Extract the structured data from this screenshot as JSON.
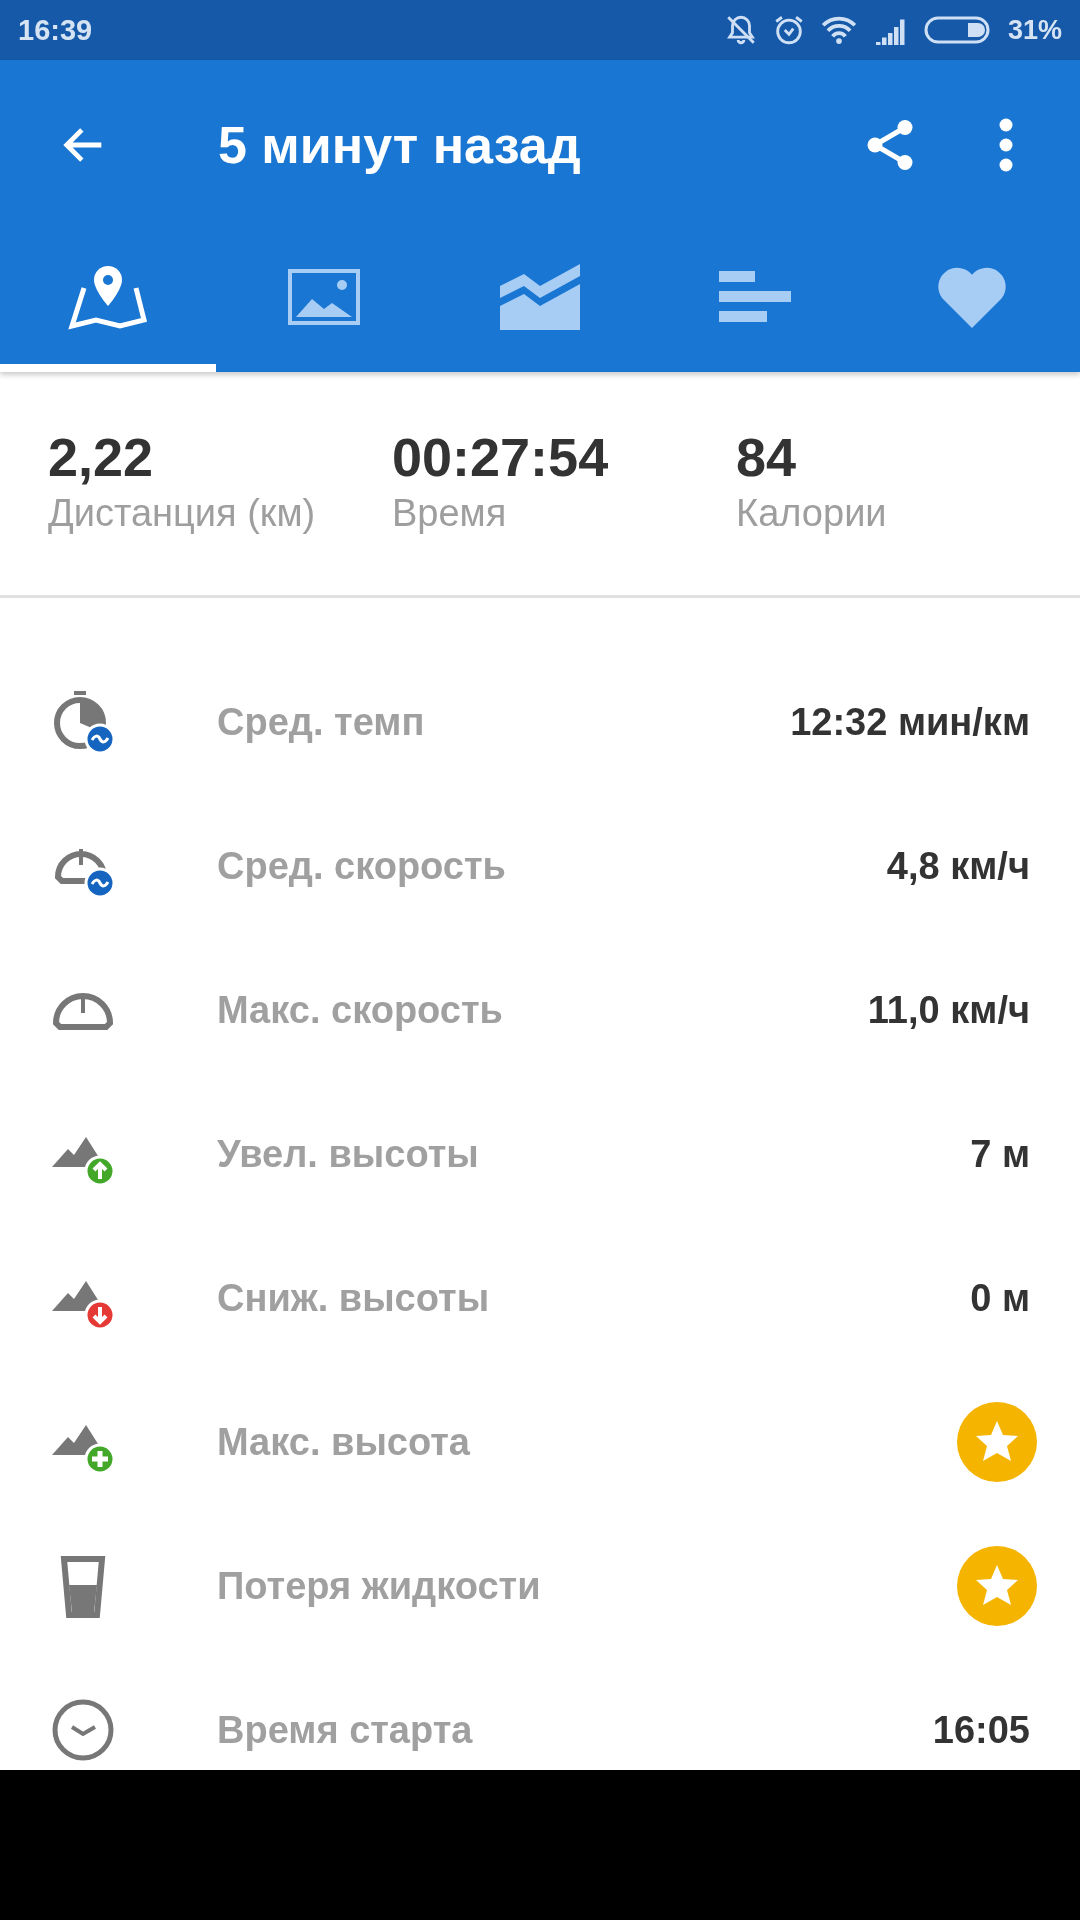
{
  "status_bar": {
    "time": "16:39",
    "battery": "31%"
  },
  "app_bar": {
    "title": "5 минут назад"
  },
  "tabs": [
    {
      "kind": "map",
      "selected": true
    },
    {
      "kind": "photo",
      "selected": false
    },
    {
      "kind": "chart",
      "selected": false
    },
    {
      "kind": "splits",
      "selected": false
    },
    {
      "kind": "heart",
      "selected": false
    }
  ],
  "summary": [
    {
      "value": "2,22",
      "label": "Дистанция (км)"
    },
    {
      "value": "00:27:54",
      "label": "Время"
    },
    {
      "value": "84",
      "label": "Калории"
    }
  ],
  "stats": [
    {
      "label": "Сред. темп",
      "kind": "text",
      "value": "12:32 мин/км"
    },
    {
      "label": "Сред. скорость",
      "kind": "text",
      "value": "4,8 км/ч"
    },
    {
      "label": "Макс. скорость",
      "kind": "text",
      "value": "11,0 км/ч"
    },
    {
      "label": "Увел. высоты",
      "kind": "text",
      "value": "7 м"
    },
    {
      "label": "Сниж. высоты",
      "kind": "text",
      "value": "0 м"
    },
    {
      "label": "Макс. высота",
      "kind": "premium"
    },
    {
      "label": "Потеря жидкости",
      "kind": "premium"
    },
    {
      "label": "Время старта",
      "kind": "text",
      "value": "16:05"
    }
  ]
}
